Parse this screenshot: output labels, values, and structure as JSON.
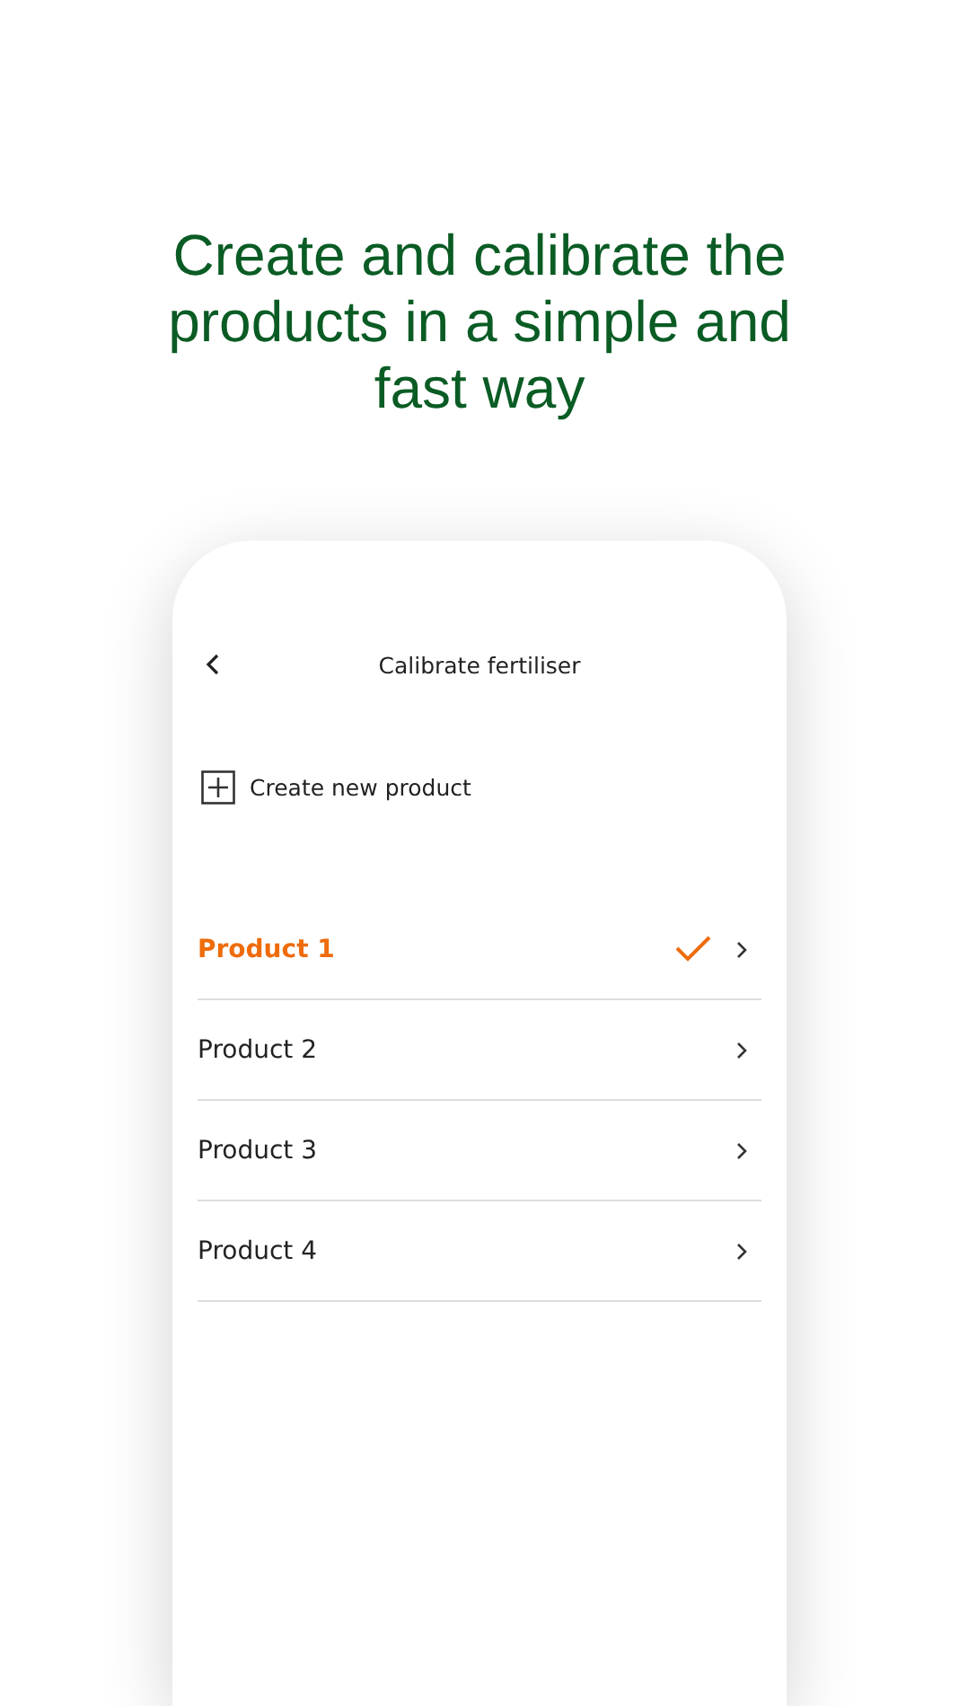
{
  "headline": "Create and calibrate the products in a simple and fast way",
  "screen": {
    "title": "Calibrate fertiliser",
    "create_action": "Create new product",
    "products": [
      {
        "name": "Product 1",
        "selected": true
      },
      {
        "name": "Product 2",
        "selected": false
      },
      {
        "name": "Product 3",
        "selected": false
      },
      {
        "name": "Product 4",
        "selected": false
      }
    ]
  }
}
